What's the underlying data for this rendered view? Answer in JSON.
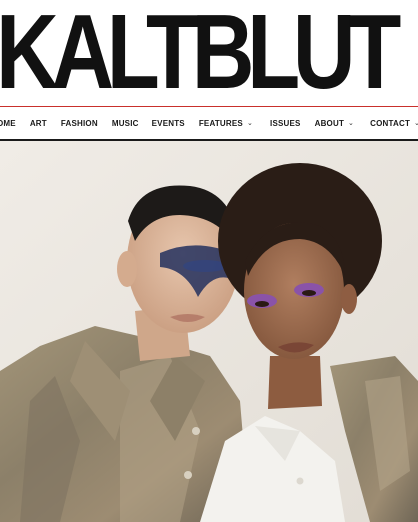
{
  "masthead": {
    "logo_text": "KALTBLUT"
  },
  "nav": {
    "items": [
      {
        "label": "OME",
        "has_dropdown": false
      },
      {
        "label": "ART",
        "has_dropdown": false
      },
      {
        "label": "FASHION",
        "has_dropdown": false
      },
      {
        "label": "MUSIC",
        "has_dropdown": false
      },
      {
        "label": "EVENTS",
        "has_dropdown": false
      },
      {
        "label": "FEATURES",
        "has_dropdown": true
      },
      {
        "label": "ISSUES",
        "has_dropdown": false
      },
      {
        "label": "ABOUT",
        "has_dropdown": true
      },
      {
        "label": "CONTACT",
        "has_dropdown": true
      }
    ],
    "dropdown_icon": "chevron-down-icon"
  },
  "colors": {
    "logo": "#111111",
    "accent_rule": "#c9302c",
    "nav_text": "#1a1a1a",
    "hero_background": "#eae6df"
  }
}
